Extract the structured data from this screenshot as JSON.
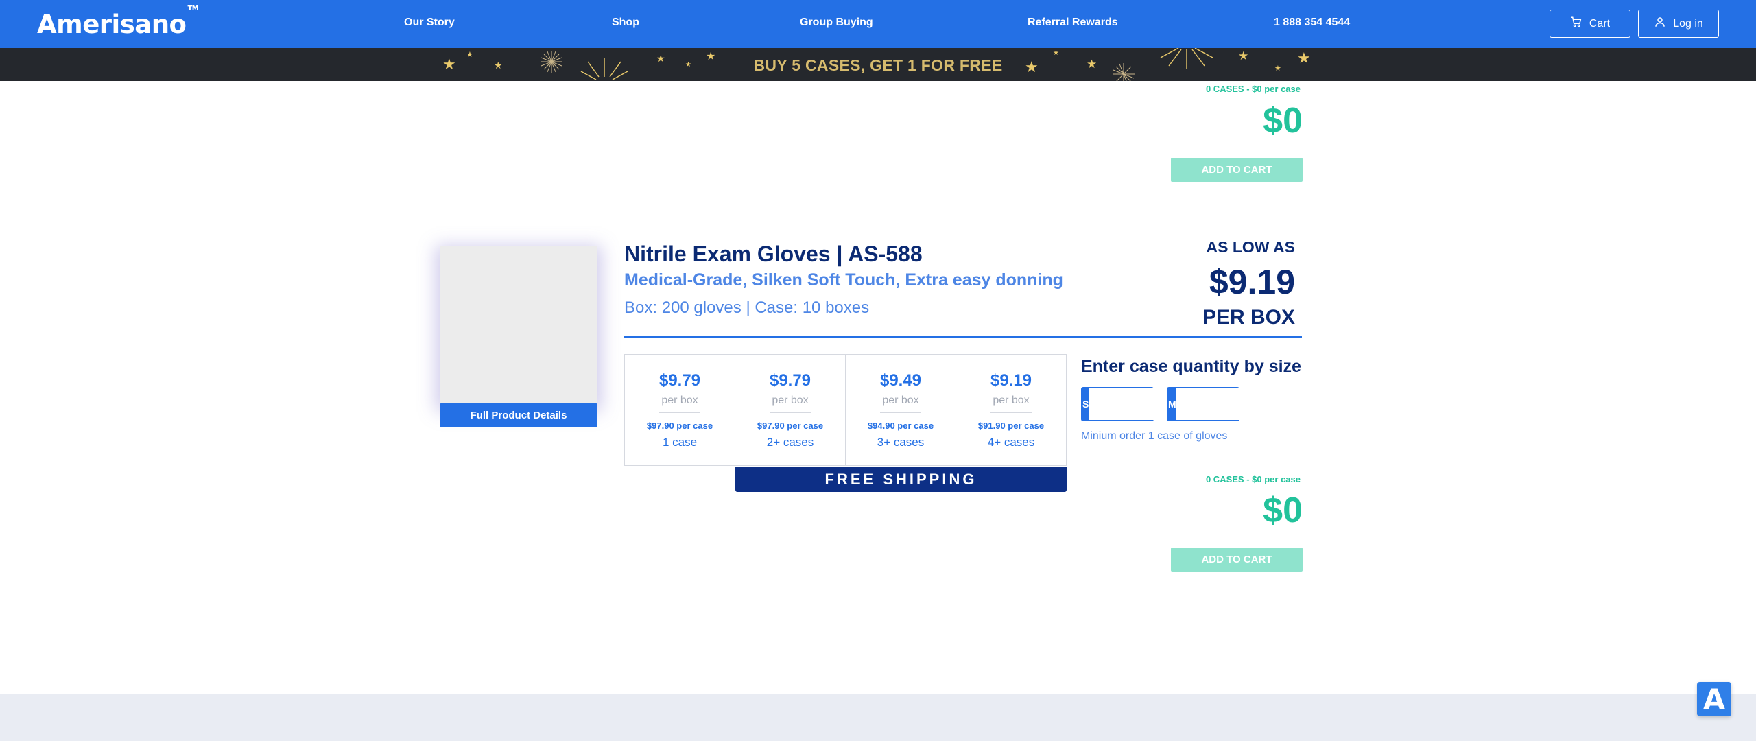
{
  "header": {
    "logo": "Amerisano",
    "logo_tm": "TM",
    "nav": [
      "Our Story",
      "Shop",
      "Group Buying",
      "Referral Rewards",
      "1 888 354 4544"
    ],
    "cart_label": "Cart",
    "login_label": "Log in",
    "background_color": "#2470e5"
  },
  "promo": {
    "text": "BUY 5 CASES, GET 1 FOR FREE",
    "background_color": "#25282d",
    "text_color": "#d6bb6e"
  },
  "previous_product": {
    "cases_note": "0 CASES - $0 per case",
    "total": "$0",
    "add_to_cart": "ADD TO CART"
  },
  "product": {
    "title": "Nitrile Exam Gloves | AS-588",
    "subtitle": "Medical-Grade, Silken Soft Touch, Extra easy donning",
    "packaging": "Box: 200 gloves | Case: 10 boxes",
    "details_button": "Full Product Details",
    "as_low_as": "AS LOW AS",
    "lowest_price": "$9.19",
    "per_box_label": "PER BOX",
    "tiers": [
      {
        "price": "$9.79",
        "unit": "per box",
        "case_price": "$97.90 per case",
        "qty": "1 case"
      },
      {
        "price": "$9.79",
        "unit": "per box",
        "case_price": "$97.90 per case",
        "qty": "2+ cases"
      },
      {
        "price": "$9.49",
        "unit": "per box",
        "case_price": "$94.90 per case",
        "qty": "3+ cases"
      },
      {
        "price": "$9.19",
        "unit": "per box",
        "case_price": "$91.90 per case",
        "qty": "4+ cases"
      }
    ],
    "free_shipping": "FREE SHIPPING",
    "qty_title": "Enter case quantity by size",
    "sizes": [
      {
        "label": "S",
        "value": ""
      },
      {
        "label": "M",
        "value": ""
      }
    ],
    "min_order": "Minium order 1 case of gloves",
    "cases_note": "0 CASES - $0 per case",
    "total": "$0",
    "add_to_cart": "ADD TO CART",
    "accent_color": "#2470e5",
    "total_color": "#22c29b"
  },
  "accessibility_button": "A"
}
